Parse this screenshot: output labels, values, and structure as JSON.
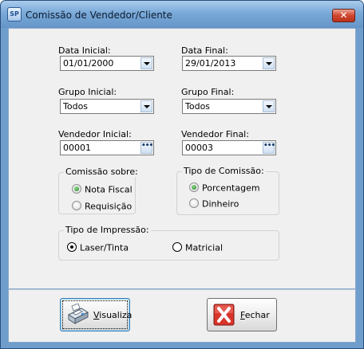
{
  "window": {
    "title": "Comissão de Vendedor/Cliente",
    "app_icon_text": "SP",
    "close_label": "✕"
  },
  "fields": {
    "data_inicial": {
      "label": "Data Inicial:",
      "value": "01/01/2000"
    },
    "data_final": {
      "label": "Data Final:",
      "value": "29/01/2013"
    },
    "grupo_inicial": {
      "label": "Grupo Inicial:",
      "value": "Todos"
    },
    "grupo_final": {
      "label": "Grupo Final:",
      "value": "Todos"
    },
    "vendedor_inicial": {
      "label": "Vendedor Inicial:",
      "value": "00001"
    },
    "vendedor_final": {
      "label": "Vendedor Final:",
      "value": "00003"
    }
  },
  "comissao_sobre": {
    "title": "Comissão sobre:",
    "options": [
      {
        "label": "Nota Fiscal",
        "selected": true
      },
      {
        "label": "Requisição",
        "selected": false
      }
    ]
  },
  "tipo_comissao": {
    "title": "Tipo de Comissão:",
    "options": [
      {
        "label": "Porcentagem",
        "selected": true
      },
      {
        "label": "Dinheiro",
        "selected": false
      }
    ]
  },
  "tipo_impressao": {
    "title": "Tipo de Impressão:",
    "options": [
      {
        "label": "Laser/Tinta",
        "selected": true
      },
      {
        "label": "Matricial",
        "selected": false
      }
    ]
  },
  "buttons": {
    "visualiza": {
      "label": "Visualiza",
      "icon": "printer-icon"
    },
    "fechar": {
      "label": "Fechar",
      "icon": "red-x-icon"
    }
  },
  "icons": {
    "dropdown": "chevron-down-icon",
    "ellipsis_glyph": "•••"
  },
  "colors": {
    "window_frame": "#6f9ecd",
    "dialog_bg": "#f0f0f0",
    "close_button": "#c8412b",
    "radio_selected_green": "#2a8a2a"
  }
}
